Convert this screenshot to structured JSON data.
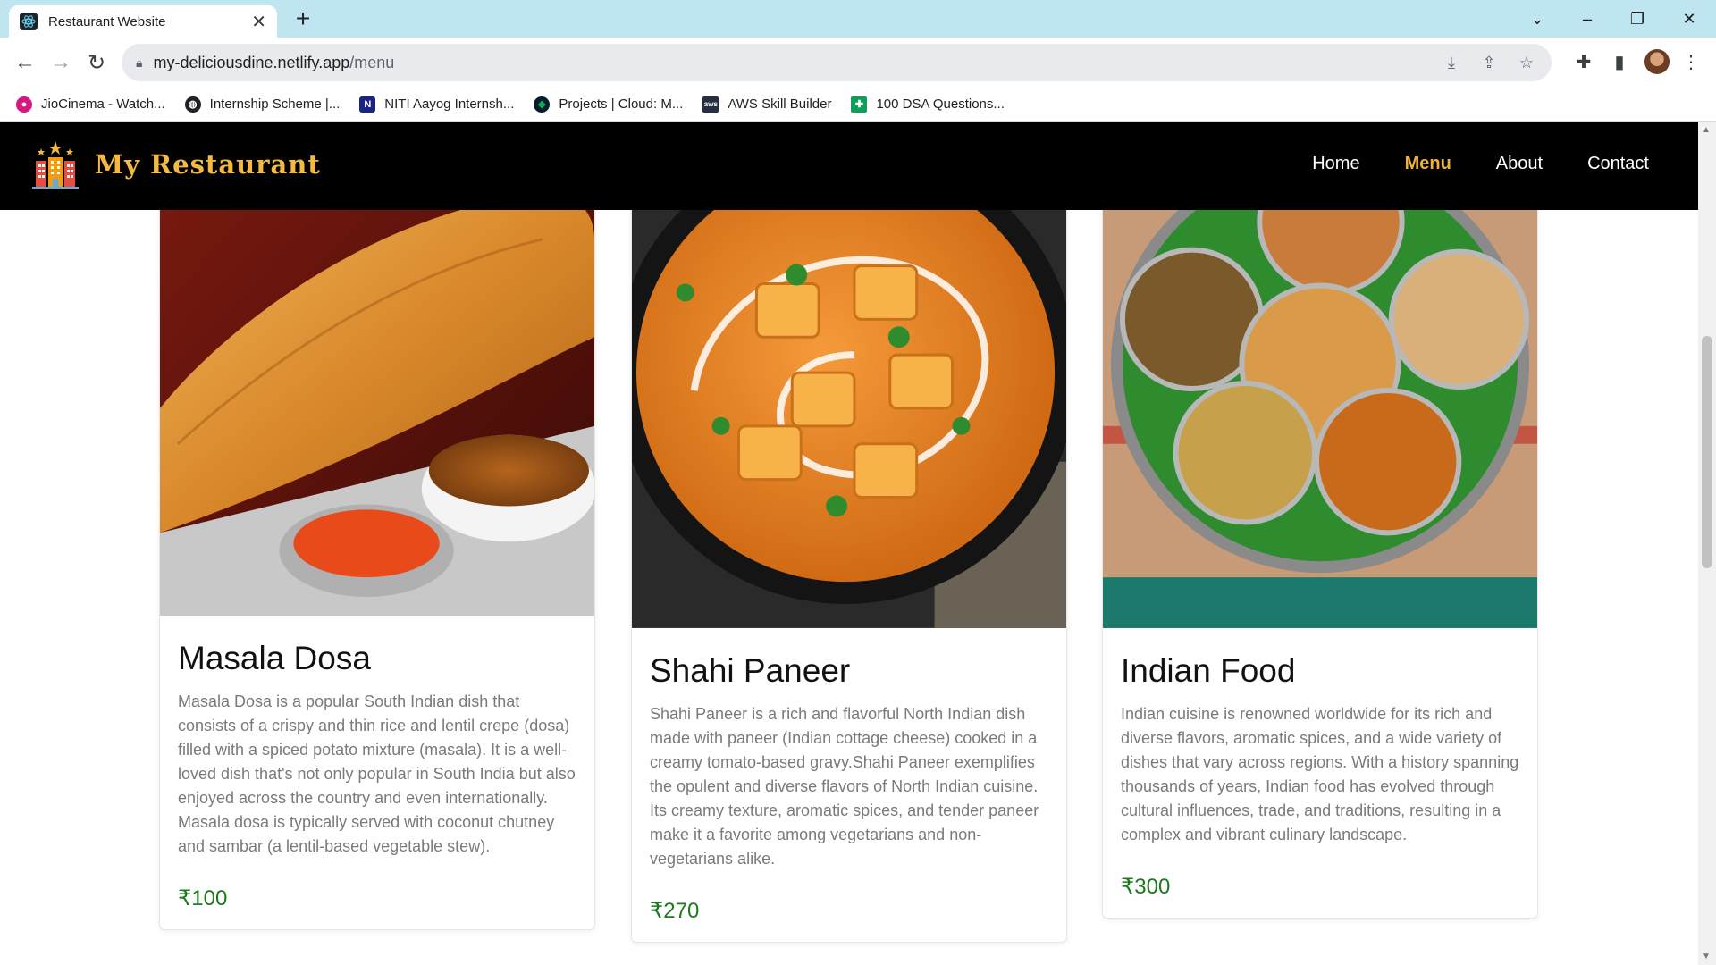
{
  "browser": {
    "tab_title": "Restaurant Website",
    "url_host": "my-deliciousdine.netlify.app",
    "url_path": "/menu",
    "bookmarks": [
      {
        "label": "JioCinema - Watch...",
        "icon": "jiocinema-icon",
        "color": "#d6177f"
      },
      {
        "label": "Internship Scheme |...",
        "icon": "globe-icon",
        "color": "#202124"
      },
      {
        "label": "NITI Aayog Internsh...",
        "icon": "niti-aayog-icon",
        "color": "#1a237e"
      },
      {
        "label": "Projects | Cloud: M...",
        "icon": "mongodb-leaf-icon",
        "color": "#13aa52"
      },
      {
        "label": "AWS Skill Builder",
        "icon": "aws-icon",
        "color": "#232f3e"
      },
      {
        "label": "100 DSA Questions...",
        "icon": "google-sheets-icon",
        "color": "#0f9d58"
      }
    ]
  },
  "site": {
    "brand": "My Restaurant",
    "nav": [
      {
        "label": "Home",
        "active": false
      },
      {
        "label": "Menu",
        "active": true
      },
      {
        "label": "About",
        "active": false
      },
      {
        "label": "Contact",
        "active": false
      }
    ]
  },
  "menu": [
    {
      "title": "Masala Dosa",
      "description": "Masala Dosa is a popular South Indian dish that consists of a crispy and thin rice and lentil crepe (dosa) filled with a spiced potato mixture (masala). It is a well-loved dish that's not only popular in South India but also enjoyed across the country and even internationally. Masala dosa is typically served with coconut chutney and sambar (a lentil-based vegetable stew).",
      "price": "₹100"
    },
    {
      "title": "Shahi Paneer",
      "description": "Shahi Paneer is a rich and flavorful North Indian dish made with paneer (Indian cottage cheese) cooked in a creamy tomato-based gravy.Shahi Paneer exemplifies the opulent and diverse flavors of North Indian cuisine. Its creamy texture, aromatic spices, and tender paneer make it a favorite among vegetarians and non-vegetarians alike.",
      "price": "₹270"
    },
    {
      "title": "Indian Food",
      "description": "Indian cuisine is renowned worldwide for its rich and diverse flavors, aromatic spices, and a wide variety of dishes that vary across regions. With a history spanning thousands of years, Indian food has evolved through cultural influences, trade, and traditions, resulting in a complex and vibrant culinary landscape.",
      "price": "₹300"
    }
  ]
}
